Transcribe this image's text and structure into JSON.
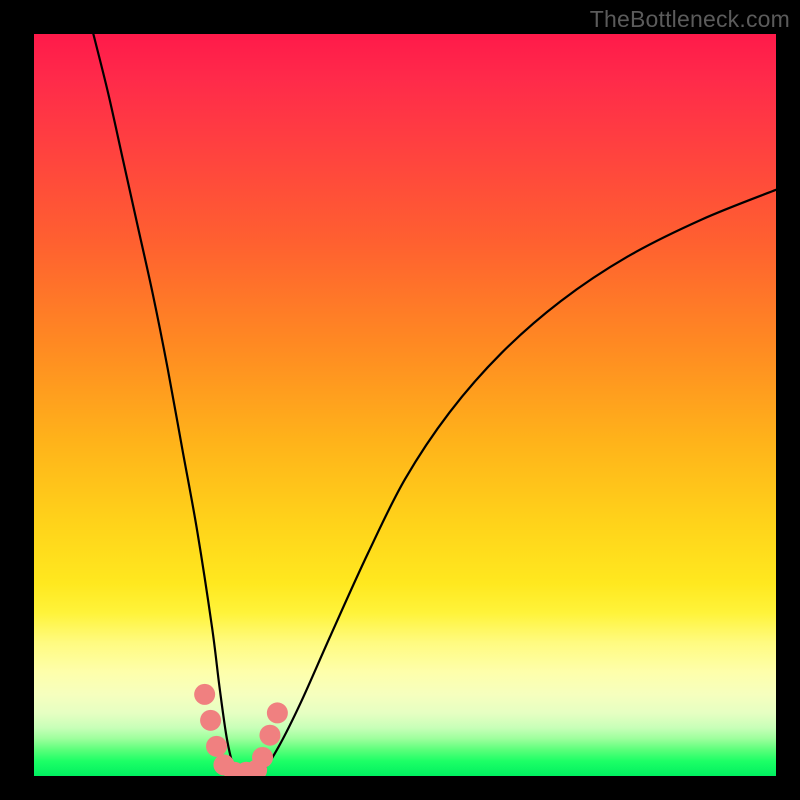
{
  "watermark": "TheBottleneck.com",
  "chart_data": {
    "type": "line",
    "title": "",
    "xlabel": "",
    "ylabel": "",
    "xlim": [
      0,
      100
    ],
    "ylim": [
      0,
      100
    ],
    "series": [
      {
        "name": "bottleneck-curve",
        "x": [
          8,
          10,
          12,
          14,
          16,
          18,
          20,
          22,
          24,
          25,
          26,
          27,
          28,
          29,
          31,
          33,
          36,
          40,
          45,
          50,
          56,
          63,
          71,
          80,
          90,
          100
        ],
        "values": [
          100,
          92,
          83,
          74,
          65,
          55,
          44,
          33,
          20,
          12,
          5,
          1,
          0,
          0,
          1,
          4,
          10,
          19,
          30,
          40,
          49,
          57,
          64,
          70,
          75,
          79
        ]
      }
    ],
    "markers": {
      "name": "highlight-dots",
      "color": "#f08080",
      "points": [
        {
          "x": 23.0,
          "y": 11.0
        },
        {
          "x": 23.8,
          "y": 7.5
        },
        {
          "x": 24.6,
          "y": 4.0
        },
        {
          "x": 25.6,
          "y": 1.5
        },
        {
          "x": 27.0,
          "y": 0.5
        },
        {
          "x": 28.6,
          "y": 0.5
        },
        {
          "x": 30.0,
          "y": 0.8
        },
        {
          "x": 30.8,
          "y": 2.5
        },
        {
          "x": 31.8,
          "y": 5.5
        },
        {
          "x": 32.8,
          "y": 8.5
        }
      ]
    },
    "gradient_stops": [
      {
        "pos": 0.0,
        "color": "#ff1a4a"
      },
      {
        "pos": 0.28,
        "color": "#ff6030"
      },
      {
        "pos": 0.55,
        "color": "#ffb31a"
      },
      {
        "pos": 0.78,
        "color": "#fff33a"
      },
      {
        "pos": 0.9,
        "color": "#e6ffc2"
      },
      {
        "pos": 1.0,
        "color": "#00f060"
      }
    ]
  }
}
